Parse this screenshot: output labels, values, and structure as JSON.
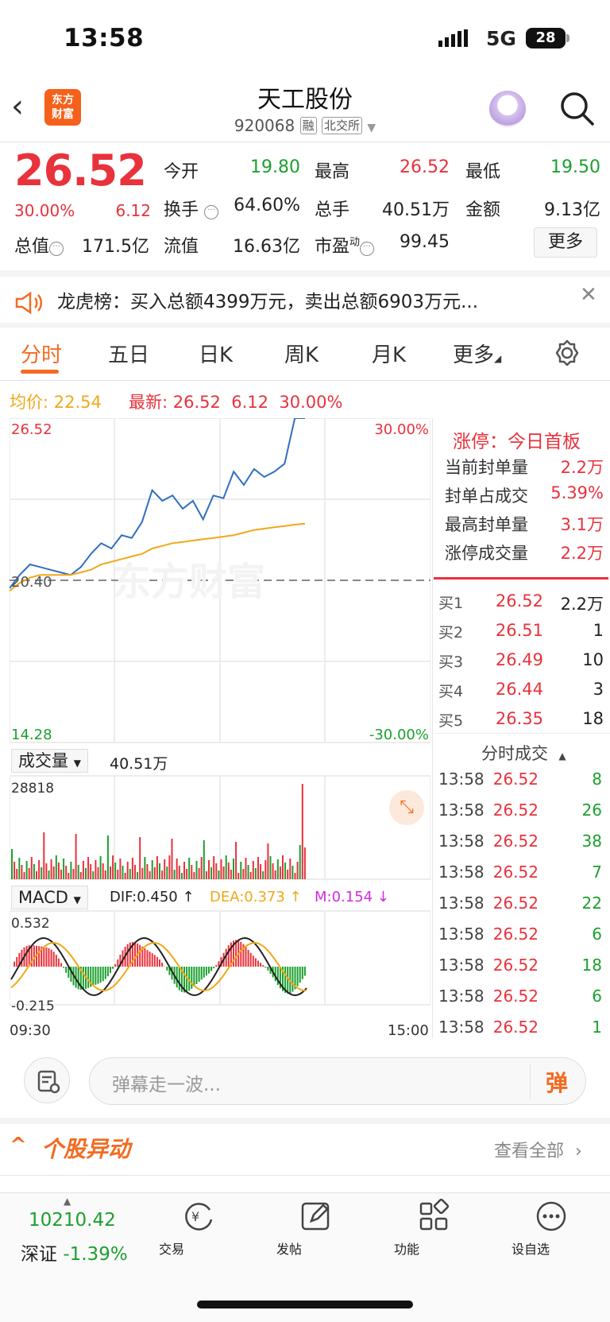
{
  "status_bar": {
    "time": "13:58",
    "network": "5G",
    "battery": "28"
  },
  "header": {
    "logo_text": "东方财富",
    "title": "天工股份",
    "code": "920068",
    "tag_margin": "融",
    "tag_exchange": "北交所"
  },
  "quote": {
    "price": "26.52",
    "change_pct": "30.00%",
    "change": "6.12",
    "open_label": "今开",
    "open": "19.80",
    "high_label": "最高",
    "high": "26.52",
    "low_label": "最低",
    "low": "19.50",
    "turnover_label": "换手",
    "turnover": "64.60%",
    "volume_label": "总手",
    "volume": "40.51万",
    "amount_label": "金额",
    "amount": "9.13亿",
    "mktcap_label": "总值",
    "mktcap": "171.5亿",
    "float_label": "流值",
    "float": "16.63亿",
    "pe_label": "市盈",
    "pe_sup": "动",
    "pe": "99.45",
    "more_label": "更多"
  },
  "banner": {
    "text": "龙虎榜：买入总额4399万元，卖出总额6903万元..."
  },
  "tabs": [
    "分时",
    "五日",
    "日K",
    "周K",
    "月K",
    "更多"
  ],
  "legend": {
    "avg_label": "均价:",
    "avg": "22.54",
    "last_label": "最新:",
    "last": "26.52",
    "chg": "6.12",
    "pct": "30.00%"
  },
  "chart": {
    "y_top": "26.52",
    "y_mid": "20.40",
    "y_bot": "14.28",
    "pct_top": "30.00%",
    "pct_bot": "-30.00%",
    "watermark": "东方财富",
    "vol_selector": "成交量",
    "vol_total": "40.51万",
    "vol_max": "28818",
    "macd_selector": "MACD",
    "dif": "DIF:0.450 ↑",
    "dea": "DEA:0.373 ↑",
    "m": "M:0.154 ↓",
    "macd_top": "0.532",
    "macd_bot": "-0.215",
    "time_start": "09:30",
    "time_end": "15:00"
  },
  "chart_data": {
    "type": "line",
    "title": "",
    "ylim": [
      14.28,
      26.52
    ],
    "series": [
      {
        "values": [
          20.1,
          20.6,
          21.0,
          20.9,
          20.8,
          20.7,
          20.6,
          20.9,
          21.4,
          21.8,
          21.6,
          22.1,
          22.0,
          22.6,
          23.8,
          23.4,
          23.6,
          23.1,
          23.4,
          22.7,
          23.6,
          23.5,
          24.5,
          24.0,
          24.6,
          24.3,
          24.5,
          24.8,
          26.52,
          26.52
        ]
      },
      {
        "values": [
          20.0,
          20.3,
          20.5,
          20.6,
          20.6,
          20.6,
          20.6,
          20.7,
          20.8,
          21.0,
          21.1,
          21.2,
          21.3,
          21.4,
          21.6,
          21.7,
          21.8,
          21.85,
          21.9,
          21.95,
          22.0,
          22.05,
          22.1,
          22.2,
          22.3,
          22.35,
          22.4,
          22.45,
          22.5,
          22.54
        ]
      }
    ]
  },
  "limit_panel": {
    "title": "涨停：今日首板",
    "rows": [
      {
        "label": "当前封单量",
        "value": "2.2万"
      },
      {
        "label": "封单占成交",
        "value": "5.39%"
      },
      {
        "label": "最高封单量",
        "value": "3.1万"
      },
      {
        "label": "涨停成交量",
        "value": "2.2万"
      }
    ]
  },
  "bids": [
    {
      "label": "买1",
      "price": "26.52",
      "vol": "2.2万"
    },
    {
      "label": "买2",
      "price": "26.51",
      "vol": "1"
    },
    {
      "label": "买3",
      "price": "26.49",
      "vol": "10"
    },
    {
      "label": "买4",
      "price": "26.44",
      "vol": "3"
    },
    {
      "label": "买5",
      "price": "26.35",
      "vol": "18"
    }
  ],
  "ticks_title": "分时成交",
  "ticks": [
    {
      "time": "13:58",
      "price": "26.52",
      "vol": "8"
    },
    {
      "time": "13:58",
      "price": "26.52",
      "vol": "26"
    },
    {
      "time": "13:58",
      "price": "26.52",
      "vol": "38"
    },
    {
      "time": "13:58",
      "price": "26.52",
      "vol": "7"
    },
    {
      "time": "13:58",
      "price": "26.52",
      "vol": "22"
    },
    {
      "time": "13:58",
      "price": "26.52",
      "vol": "6"
    },
    {
      "time": "13:58",
      "price": "26.52",
      "vol": "18"
    },
    {
      "time": "13:58",
      "price": "26.52",
      "vol": "6"
    },
    {
      "time": "13:58",
      "price": "26.52",
      "vol": "1"
    }
  ],
  "danmu": {
    "placeholder": "弹幕走一波...",
    "button": "弹"
  },
  "anomaly": {
    "title": "个股异动",
    "view_all": "查看全部"
  },
  "nav": {
    "index_value": "10210.42",
    "index_name": "深证",
    "index_chg": "-1.39%",
    "items": [
      "交易",
      "发帖",
      "功能",
      "设自选"
    ]
  },
  "colors": {
    "accent": "#f36b21",
    "up": "#e8323c",
    "down": "#1ca02f",
    "avg": "#f0a818",
    "price_line": "#2f6fc0"
  }
}
